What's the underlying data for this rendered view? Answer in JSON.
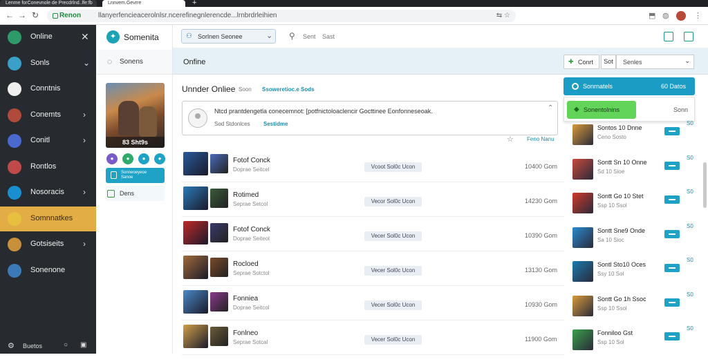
{
  "browser": {
    "tab1_title": "Lenme forConevnole de Precdrlnd..lfe:fb",
    "tab2_title": "Lnnvem.Gevrre",
    "new_tab": "+",
    "chip": "Renon",
    "url": "llanyerfencieacerolnlsr.ncerefinegnlerencde...lrnbrdrleihien"
  },
  "sidebar": {
    "close": "✕",
    "items": [
      {
        "label": "Online",
        "color": "#2e9a6a"
      },
      {
        "label": "Sonls",
        "color": "#3aa0c8",
        "chevron": "⌄"
      },
      {
        "label": "Conntnis",
        "color": "#f0f0f0"
      },
      {
        "label": "Conemts",
        "color": "#b04a3a",
        "chevron": "›"
      },
      {
        "label": "Conitl",
        "color": "#4a6ad0",
        "chevron": "›"
      },
      {
        "label": "Rontlos",
        "color": "#c04a4a"
      },
      {
        "label": "Nosoracis",
        "color": "#1a8fd0",
        "chevron": "›"
      },
      {
        "label": "Somnnatkes",
        "color": "#e8c040"
      },
      {
        "label": "Gotsiseits",
        "color": "#c8903a",
        "chevron": "›"
      },
      {
        "label": "Sonenone",
        "color": "#3a7ab8"
      }
    ],
    "footer_label": "Buetos"
  },
  "subpanel": {
    "brand": "Somenita",
    "search_label": "Sonens",
    "art_caption": "83 Sht9s",
    "chip_colors": [
      "#7a5ac8",
      "#2eaa6a",
      "#1ea3c6",
      "#1ea3c6"
    ],
    "blue_card_line1": "Sonneoeyeoe",
    "blue_card_line2": "Sanoe",
    "green_label": "Dens"
  },
  "header": {
    "dropdown_label": "Sorlnen Seonee",
    "search_label": "Sent",
    "search_label2": "Sast"
  },
  "title_bar": {
    "label": "Onfine",
    "filter_label": "Conrt",
    "small_btn": "Sot",
    "sort_label": "Senles"
  },
  "section": {
    "title": "Unnder Onliee",
    "meta": "Soon",
    "link": "Ssoweretioc.e Sods"
  },
  "comment": {
    "text": "Ntcd prantdengetla conecemnot: [potfnictoloaclencir Gocttinee Eonfonneseoak.",
    "sub": "Sod Stdonlces",
    "link": "Sestidme",
    "star_label": "Feno Nanu"
  },
  "rows": [
    {
      "title": "Fotof Conck",
      "sub": "Doprae Seitcel",
      "tag": "Vcoot Sol0c Ucon",
      "num": "10400 Gom",
      "c1": "#2a5a9a",
      "c2": "#4a6ab8"
    },
    {
      "title": "Rotimed",
      "sub": "Seprae Setcol",
      "tag": "Vecor Sol0c Ucon",
      "num": "14230 Gom",
      "c1": "#2a7ab8",
      "c2": "#3a5a3a"
    },
    {
      "title": "Fotof Conck",
      "sub": "Doprae Seiteol",
      "tag": "Vecer Sol0c Ucon",
      "num": "10390 Gom",
      "c1": "#c02a2a",
      "c2": "#3a3a6a"
    },
    {
      "title": "Rocloed",
      "sub": "Seprae Sotctol",
      "tag": "Vecer Sol0c Ucon",
      "num": "13130 Gom",
      "c1": "#a06a3a",
      "c2": "#7a4a2a"
    },
    {
      "title": "Fonniea",
      "sub": "Doprae Seitcol",
      "tag": "Vecer Sol0c Ucon",
      "num": "10930 Gom",
      "c1": "#4a8ac8",
      "c2": "#8a3a8a"
    },
    {
      "title": "Fonlneo",
      "sub": "Seprae Sotcal",
      "tag": "Vecer Sol0c Ucon",
      "num": "11900 Gom",
      "c1": "#d0a04a",
      "c2": "#6a5a3a"
    }
  ],
  "right_panel": {
    "top_label": "Sonrnatels",
    "top_value": "60 Datos",
    "green_btn_label": "Sonentolnins",
    "green_value": "Sonn",
    "rows": [
      {
        "title": "Sontos 10 Dnne",
        "sub": "Ceno Sosto",
        "num": "S0",
        "color": "#d89a3a"
      },
      {
        "title": "Sontt Sn 10 Onne",
        "sub": "Sd 10 Sioe",
        "num": "S0",
        "color": "#c84a3a"
      },
      {
        "title": "Sontt Go 10 Stet",
        "sub": "Ssp 10 Ssol",
        "num": "S0",
        "color": "#d03a2a"
      },
      {
        "title": "Sontt Sne9 Onde",
        "sub": "Sa 10 Sioc",
        "num": "S0",
        "color": "#2a8ad0"
      },
      {
        "title": "Sontl Sto10 Oces",
        "sub": "Ssy 10 Sol",
        "num": "S0",
        "color": "#1a7ab0"
      },
      {
        "title": "Sontt Go 1h Ssoc",
        "sub": "Ssp 10 Ssol",
        "num": "S0",
        "color": "#d89a3a"
      },
      {
        "title": "Fonniloo Gst",
        "sub": "Ssp 10 Sol",
        "num": "S0",
        "color": "#3aa04a"
      }
    ]
  }
}
